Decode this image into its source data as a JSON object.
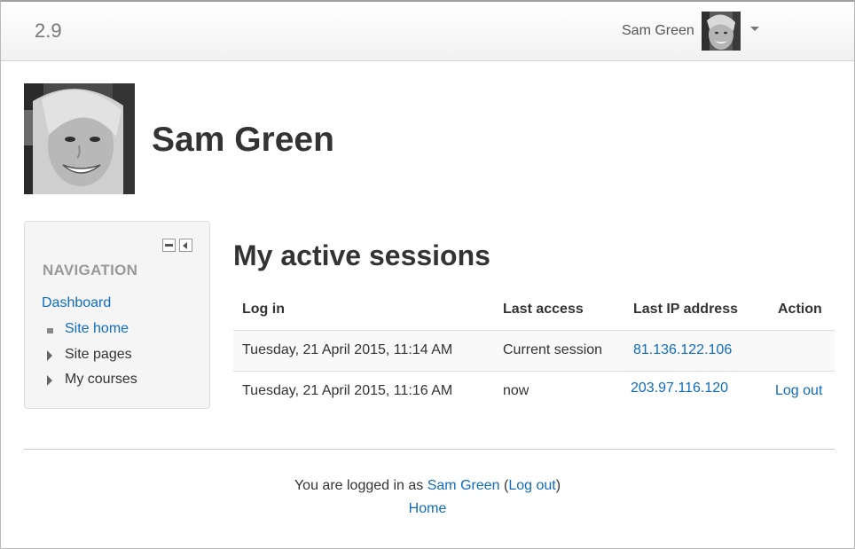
{
  "navbar": {
    "brand": "2.9",
    "user_name": "Sam Green"
  },
  "header": {
    "profile_name": "Sam Green"
  },
  "navigation_block": {
    "title": "NAVIGATION",
    "items": [
      {
        "label": "Dashboard"
      },
      {
        "label": "Site home"
      },
      {
        "label": "Site pages"
      },
      {
        "label": "My courses"
      }
    ]
  },
  "main": {
    "title": "My active sessions",
    "table": {
      "headers": [
        "Log in",
        "Last access",
        "Last IP address",
        "Action"
      ],
      "rows": [
        {
          "login": "Tuesday, 21 April 2015, 11:14 AM",
          "last_access": "Current session",
          "ip": "81.136.122.106",
          "action": ""
        },
        {
          "login": "Tuesday, 21 April 2015, 11:16 AM",
          "last_access": "now",
          "ip": "203.97.116.120",
          "action": "Log out"
        }
      ]
    }
  },
  "footer": {
    "logged_in_prefix": "You are logged in as ",
    "user_link": "Sam Green",
    "open_paren": " (",
    "logout_link": "Log out",
    "close_paren": ")",
    "home_link": "Home"
  },
  "colors": {
    "link": "#0f6cbf",
    "navbar_bg": "#f1f1f1",
    "block_bg": "#f5f5f5"
  }
}
